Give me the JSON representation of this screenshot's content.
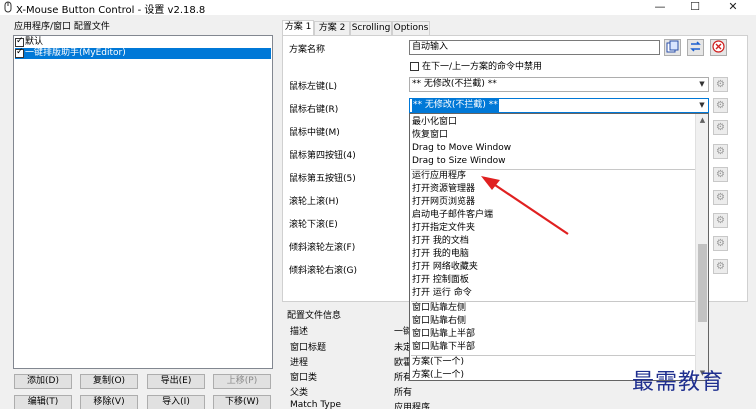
{
  "window": {
    "title": "X-Mouse Button Control - 设置 v2.18.8",
    "minimize": "—",
    "maximize": "☐",
    "close": "✕"
  },
  "left": {
    "label": "应用程序/窗口 配置文件",
    "items": [
      {
        "label": "默认",
        "checked": true,
        "selected": false
      },
      {
        "label": "一键排版助手(MyEditor)",
        "checked": true,
        "selected": true
      }
    ],
    "buttons": {
      "add": "添加(D)",
      "copy": "复制(O)",
      "export": "导出(E)",
      "move_up": "上移(P)",
      "edit": "编辑(T)",
      "remove": "移除(V)",
      "import": "导入(I)",
      "move_down": "下移(W)"
    }
  },
  "tabs": [
    "方案 1",
    "方案 2",
    "Scrolling",
    "Options"
  ],
  "form": {
    "scheme_name_label": "方案名称",
    "scheme_name_value": "自动输入",
    "disable_check_label": "在下一/上一方案的命令中禁用",
    "rows": [
      {
        "label": "鼠标左键(L)",
        "value": "** 无修改(不拦截) **"
      },
      {
        "label": "鼠标右键(R)",
        "value": "** 无修改(不拦截) **"
      },
      {
        "label": "鼠标中键(M)",
        "value": ""
      },
      {
        "label": "鼠标第四按钮(4)",
        "value": ""
      },
      {
        "label": "鼠标第五按钮(5)",
        "value": ""
      },
      {
        "label": "滚轮上滚(H)",
        "value": ""
      },
      {
        "label": "滚轮下滚(E)",
        "value": ""
      },
      {
        "label": "倾斜滚轮左滚(F)",
        "value": ""
      },
      {
        "label": "倾斜滚轮右滚(G)",
        "value": ""
      }
    ]
  },
  "dropdown": {
    "items": [
      "最小化窗口",
      "恢复窗口",
      "Drag to Move Window",
      "Drag to Size Window",
      "运行应用程序",
      "打开资源管理器",
      "打开网页浏览器",
      "启动电子邮件客户端",
      "打开指定文件夹",
      "打开 我的文档",
      "打开 我的电脑",
      "打开 网络收藏夹",
      "打开 控制面板",
      "打开 运行 命令",
      "窗口贴靠左侧",
      "窗口贴靠右侧",
      "窗口贴靠上半部",
      "窗口贴靠下半部",
      "方案(下一个)",
      "方案(上一个)"
    ],
    "scroll_position": 0.72
  },
  "info": {
    "title": "配置文件信息",
    "rows": [
      {
        "key": "描述",
        "value": "一键"
      },
      {
        "key": "窗口标题",
        "value": "未定"
      },
      {
        "key": "进程",
        "value": "欧霍"
      },
      {
        "key": "窗口类",
        "value": "所有"
      },
      {
        "key": "父类",
        "value": "所有"
      },
      {
        "key": "Match Type",
        "value": "应用程序"
      }
    ]
  },
  "watermark": "最需教育",
  "colors": {
    "selection": "#0078d7",
    "arrow": "#e02020",
    "watermark": "#1f2f8f"
  }
}
